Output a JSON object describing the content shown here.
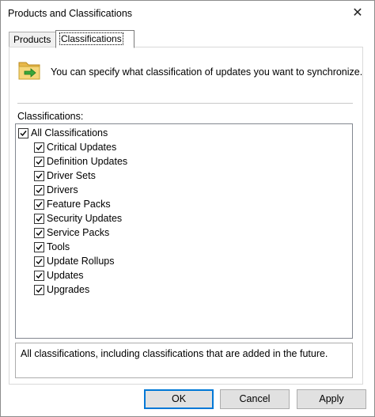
{
  "window": {
    "title": "Products and Classifications",
    "close_glyph": "✕"
  },
  "tabs": [
    {
      "label": "Products",
      "active": false
    },
    {
      "label": "Classifications",
      "active": true
    }
  ],
  "description": "You can specify what classification of updates you want to synchronize.",
  "section_label": "Classifications:",
  "tree": {
    "root": {
      "label": "All Classifications",
      "checked": true
    },
    "children": [
      {
        "label": "Critical Updates",
        "checked": true
      },
      {
        "label": "Definition Updates",
        "checked": true
      },
      {
        "label": "Driver Sets",
        "checked": true
      },
      {
        "label": "Drivers",
        "checked": true
      },
      {
        "label": "Feature Packs",
        "checked": true
      },
      {
        "label": "Security Updates",
        "checked": true
      },
      {
        "label": "Service Packs",
        "checked": true
      },
      {
        "label": "Tools",
        "checked": true
      },
      {
        "label": "Update Rollups",
        "checked": true
      },
      {
        "label": "Updates",
        "checked": true
      },
      {
        "label": "Upgrades",
        "checked": true
      }
    ]
  },
  "info_text": "All classifications, including classifications that are added in the future.",
  "buttons": {
    "ok": "OK",
    "cancel": "Cancel",
    "apply": "Apply"
  },
  "icons": {
    "folder": "folder-sync-icon",
    "check": "checkmark-icon"
  },
  "colors": {
    "accent": "#0078d7",
    "folder": "#f5d67a",
    "arrow": "#3aa63a"
  }
}
